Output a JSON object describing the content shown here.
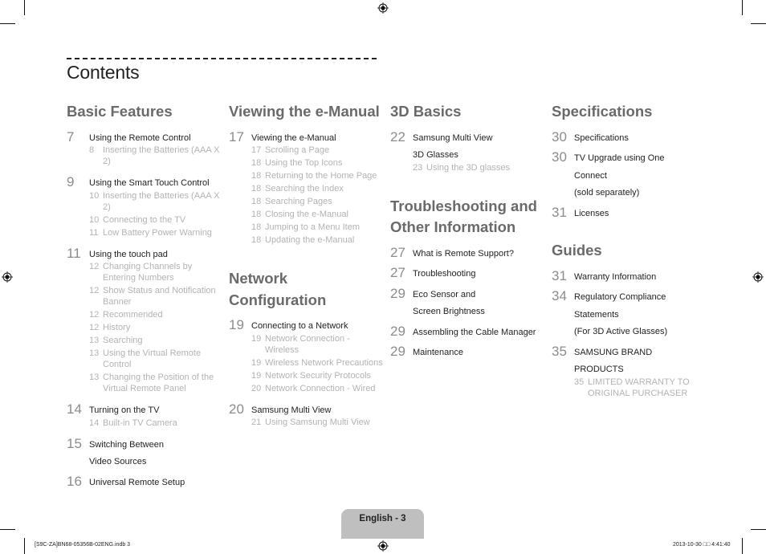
{
  "page_title": "Contents",
  "columns": [
    {
      "sections": [
        {
          "title": "Basic Features",
          "entries": [
            {
              "page": "7",
              "label_lines": [
                "Using the Remote Control"
              ],
              "subs": [
                {
                  "page": "8",
                  "text": "Inserting the Batteries (AAA X 2)"
                }
              ]
            },
            {
              "page": "9",
              "label_lines": [
                "Using the Smart Touch Control"
              ],
              "subs": [
                {
                  "page": "10",
                  "text": "Inserting the Batteries (AAA X 2)"
                },
                {
                  "page": "10",
                  "text": "Connecting to the TV"
                },
                {
                  "page": "11",
                  "text": "Low Battery Power Warning"
                }
              ]
            },
            {
              "page": "11",
              "label_lines": [
                "Using the touch pad"
              ],
              "subs": [
                {
                  "page": "12",
                  "text": "Changing Channels by Entering Numbers"
                },
                {
                  "page": "12",
                  "text": "Show Status and Notification Banner"
                },
                {
                  "page": "12",
                  "text": "Recommended"
                },
                {
                  "page": "12",
                  "text": "History"
                },
                {
                  "page": "13",
                  "text": "Searching"
                },
                {
                  "page": "13",
                  "text": "Using the Virtual Remote Control"
                },
                {
                  "page": "13",
                  "text": "Changing the Position of the Virtual Remote Panel"
                }
              ]
            },
            {
              "page": "14",
              "label_lines": [
                "Turning on the TV"
              ],
              "subs": [
                {
                  "page": "14",
                  "text": "Built-in TV Camera"
                }
              ]
            },
            {
              "page": "15",
              "label_lines": [
                "Switching Between",
                "Video Sources"
              ],
              "subs": []
            },
            {
              "page": "16",
              "label_lines": [
                "Universal Remote Setup"
              ],
              "subs": []
            }
          ]
        }
      ]
    },
    {
      "sections": [
        {
          "title": "Viewing the e-Manual",
          "entries": [
            {
              "page": "17",
              "label_lines": [
                "Viewing the e-Manual"
              ],
              "subs": [
                {
                  "page": "17",
                  "text": "Scrolling a Page"
                },
                {
                  "page": "18",
                  "text": "Using the Top Icons"
                },
                {
                  "page": "18",
                  "text": "Returning to the Home Page"
                },
                {
                  "page": "18",
                  "text": "Searching the Index"
                },
                {
                  "page": "18",
                  "text": "Searching Pages"
                },
                {
                  "page": "18",
                  "text": "Closing the e-Manual"
                },
                {
                  "page": "18",
                  "text": "Jumping to a Menu Item"
                },
                {
                  "page": "18",
                  "text": "Updating the e-Manual"
                }
              ]
            }
          ]
        },
        {
          "title": "Network Configuration",
          "entries": [
            {
              "page": "19",
              "label_lines": [
                "Connecting to a Network"
              ],
              "subs": [
                {
                  "page": "19",
                  "text": "Network Connection - Wireless"
                },
                {
                  "page": "19",
                  "text": "Wireless Network Precautions"
                },
                {
                  "page": "19",
                  "text": "Network Security Protocols"
                },
                {
                  "page": "20",
                  "text": "Network Connection - Wired"
                }
              ]
            },
            {
              "page": "20",
              "label_lines": [
                "Samsung Multi View"
              ],
              "subs": [
                {
                  "page": "21",
                  "text": "Using Samsung Multi View"
                }
              ]
            }
          ]
        }
      ]
    },
    {
      "sections": [
        {
          "title": "3D Basics",
          "entries": [
            {
              "page": "22",
              "label_lines": [
                "Samsung Multi View",
                "3D Glasses"
              ],
              "subs": [
                {
                  "page": "23",
                  "text": "Using the 3D glasses"
                }
              ]
            }
          ]
        },
        {
          "title": "Troubleshooting and Other Information",
          "entries": [
            {
              "page": "27",
              "label_lines": [
                "What is Remote Support?"
              ],
              "subs": []
            },
            {
              "page": "27",
              "label_lines": [
                "Troubleshooting"
              ],
              "subs": []
            },
            {
              "page": "29",
              "label_lines": [
                "Eco Sensor and",
                "Screen Brightness"
              ],
              "subs": []
            },
            {
              "page": "29",
              "label_lines": [
                "Assembling the Cable Manager"
              ],
              "subs": []
            },
            {
              "page": "29",
              "label_lines": [
                "Maintenance"
              ],
              "subs": []
            }
          ]
        }
      ]
    },
    {
      "sections": [
        {
          "title": "Specifications",
          "entries": [
            {
              "page": "30",
              "label_lines": [
                "Specifications"
              ],
              "subs": []
            },
            {
              "page": "30",
              "label_lines": [
                "TV Upgrade using One",
                "Connect",
                "(sold separately)"
              ],
              "subs": []
            },
            {
              "page": "31",
              "label_lines": [
                "Licenses"
              ],
              "subs": []
            }
          ]
        },
        {
          "title": "Guides",
          "entries": [
            {
              "page": "31",
              "label_lines": [
                "Warranty Information"
              ],
              "subs": []
            },
            {
              "page": "34",
              "label_lines": [
                "Regulatory Compliance",
                "Statements",
                "(For 3D Active Glasses)"
              ],
              "subs": []
            },
            {
              "page": "35",
              "label_lines": [
                "SAMSUNG BRAND",
                "PRODUCTS"
              ],
              "subs": [
                {
                  "page": "35",
                  "text": "LIMITED WARRANTY TO ORIGINAL PURCHASER"
                }
              ]
            }
          ]
        }
      ]
    }
  ],
  "footer": {
    "page_label": "English - 3",
    "slug_file": "[S9C-ZA]BN68-05356B-02ENG.indb   3",
    "slug_date": "2013-10-30   □□ 4:41:40"
  }
}
